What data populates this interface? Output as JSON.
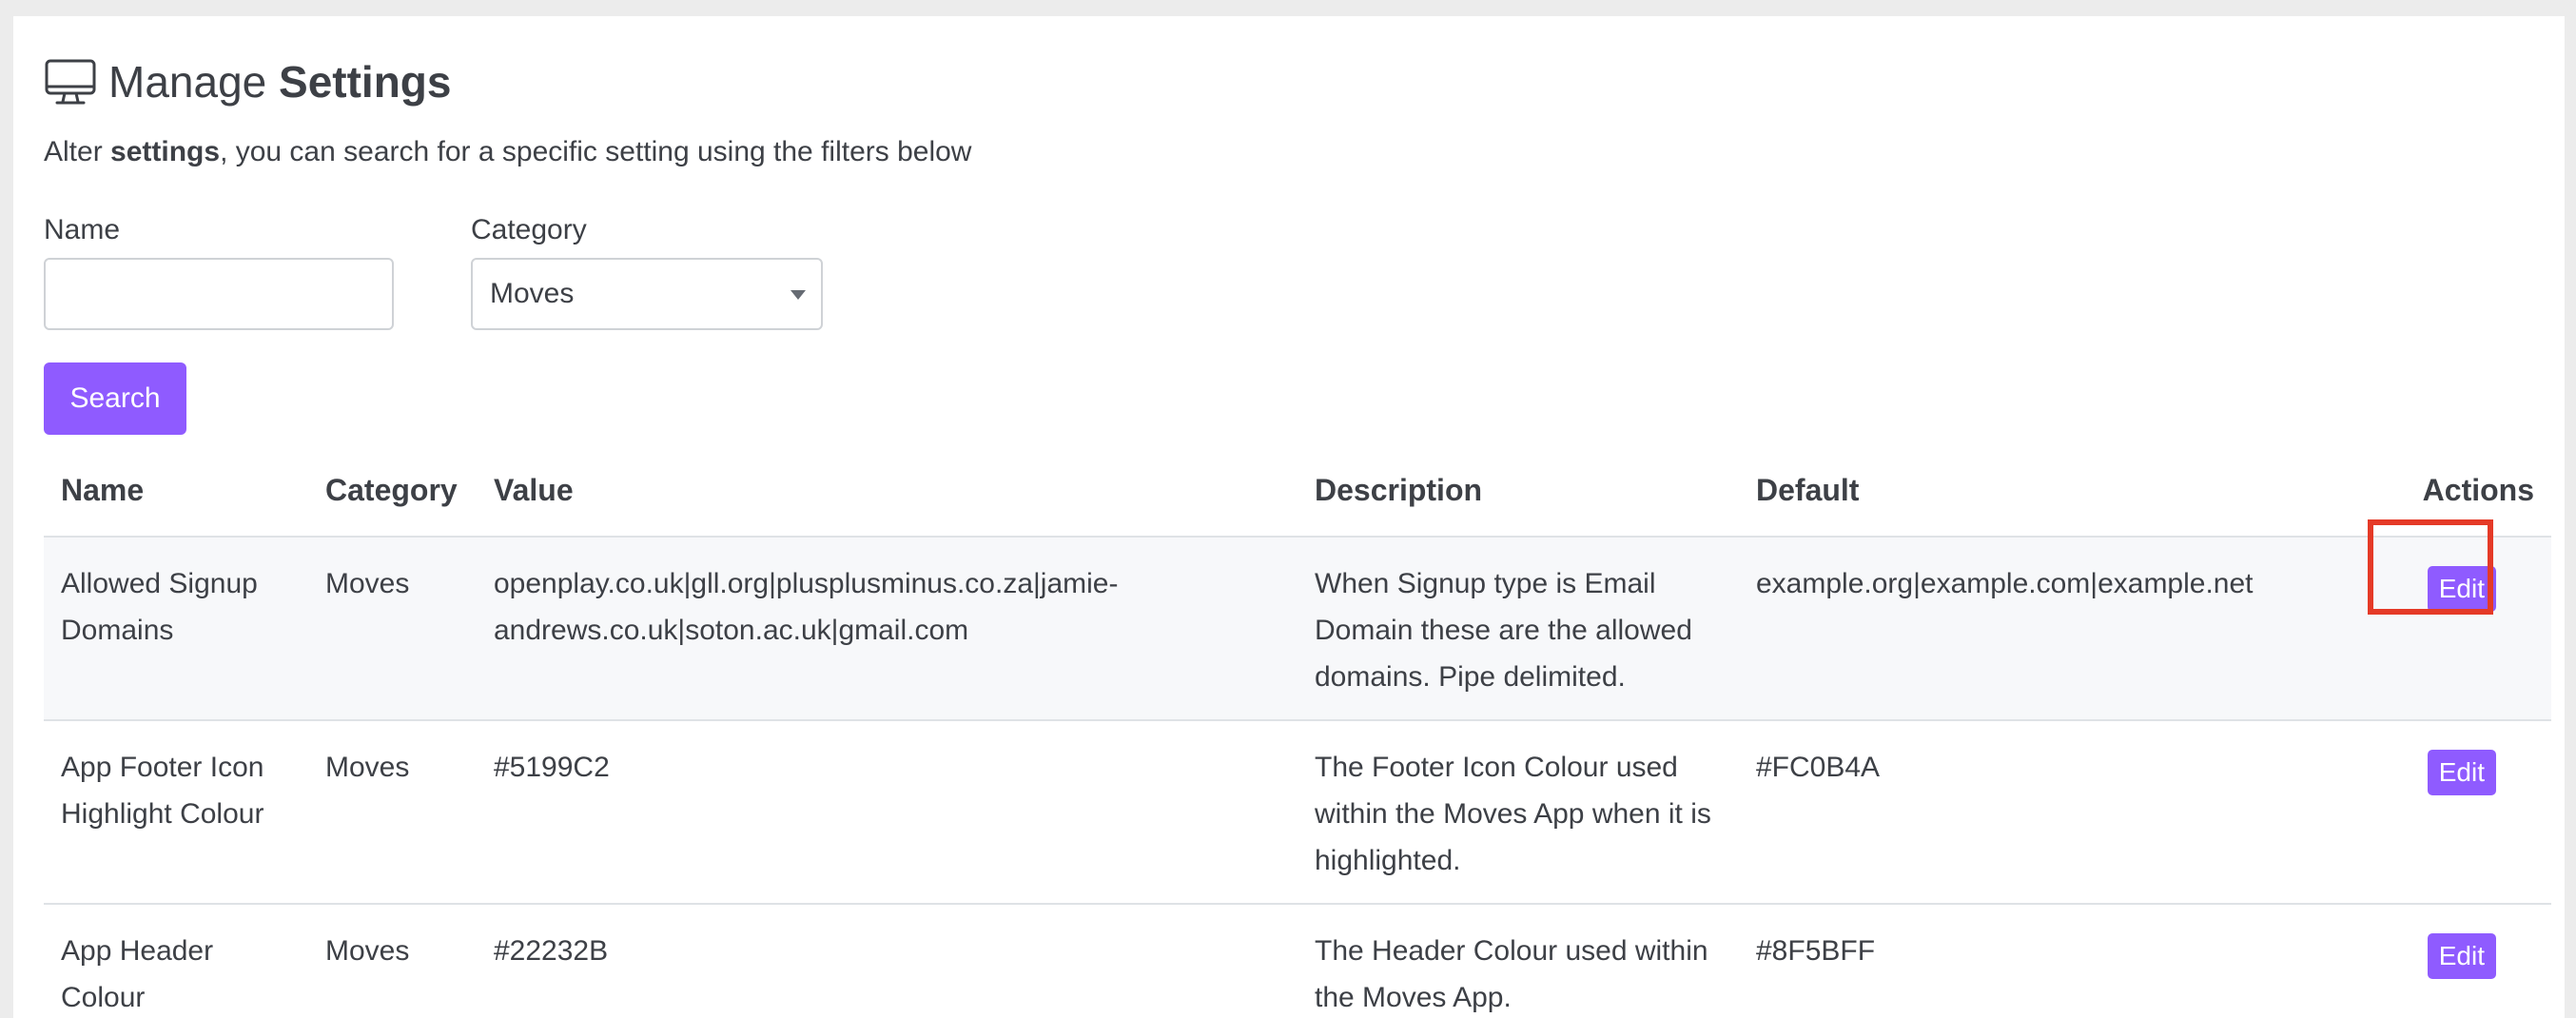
{
  "header": {
    "title_prefix": "Manage",
    "title_bold": "Settings",
    "icon": "monitor-icon",
    "subtitle_prefix": "Alter",
    "subtitle_bold": "settings",
    "subtitle_rest": ", you can search for a specific setting using the filters below"
  },
  "filters": {
    "name_label": "Name",
    "name_value": "",
    "name_placeholder": "",
    "category_label": "Category",
    "category_selected": "Moves",
    "search_label": "Search"
  },
  "table": {
    "columns": [
      "Name",
      "Category",
      "Value",
      "Description",
      "Default",
      "Actions"
    ],
    "rows": [
      {
        "name": "Allowed Signup Domains",
        "category": "Moves",
        "value": "openplay.co.uk|gll.org|plusplusminus.co.za|jamie-andrews.co.uk|soton.ac.uk|gmail.com",
        "description": "When Signup type is Email Domain these are the allowed domains. Pipe delimited.",
        "default": "example.org|example.com|example.net",
        "action_label": "Edit"
      },
      {
        "name": "App Footer Icon Highlight Colour",
        "category": "Moves",
        "value": "#5199C2",
        "description": "The Footer Icon Colour used within the Moves App when it is highlighted.",
        "default": "#FC0B4A",
        "action_label": "Edit"
      },
      {
        "name": "App Header Colour",
        "category": "Moves",
        "value": "#22232B",
        "description": "The Header Colour used within the Moves App.",
        "default": "#8F5BFF",
        "action_label": "Edit"
      }
    ]
  },
  "colors": {
    "accent": "#8F5BFF",
    "highlight": "#E53A27",
    "striped_row": "#F7F8FA"
  }
}
